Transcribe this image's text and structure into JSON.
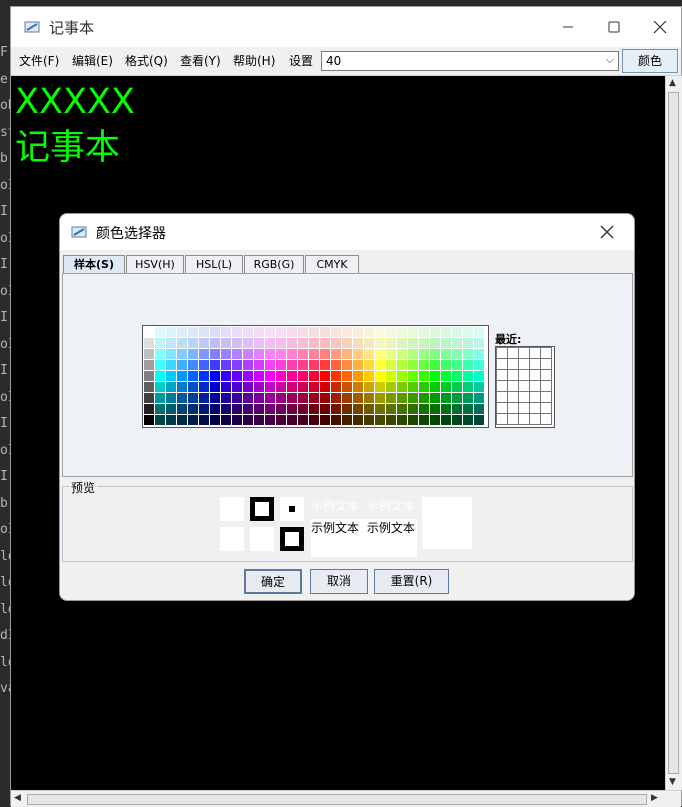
{
  "ide_strip": [
    "F.",
    "er",
    "oB",
    "st",
    "b",
    "oI",
    "I(",
    "oI",
    "I(",
    "oI",
    "I(",
    "oI",
    "I(",
    "oI",
    "I(",
    "oI",
    "I(",
    "b",
    "oI",
    "ld",
    "ld",
    "ld",
    "dI",
    "ld",
    "va"
  ],
  "window": {
    "title": "记事本"
  },
  "menu": [
    "文件(F)",
    "编辑(E)",
    "格式(Q)",
    "查看(Y)",
    "帮助(H)",
    "设置"
  ],
  "font_size_select": {
    "value": "40"
  },
  "color_button": {
    "label": "颜色"
  },
  "editor": {
    "lines": [
      "XXXXX",
      "记事本"
    ],
    "text_color": "#00ff00",
    "background": "#000000"
  },
  "dialog": {
    "title": "颜色选择器",
    "tabs": [
      "样本(S)",
      "HSV(H)",
      "HSL(L)",
      "RGB(G)",
      "CMYK"
    ],
    "selected_tab": "样本(S)",
    "recent_label": "最近:",
    "preview_label": "预览",
    "sample_text": "示例文本",
    "buttons": {
      "ok": "确定",
      "cancel": "取消",
      "reset": "重置(R)"
    }
  }
}
